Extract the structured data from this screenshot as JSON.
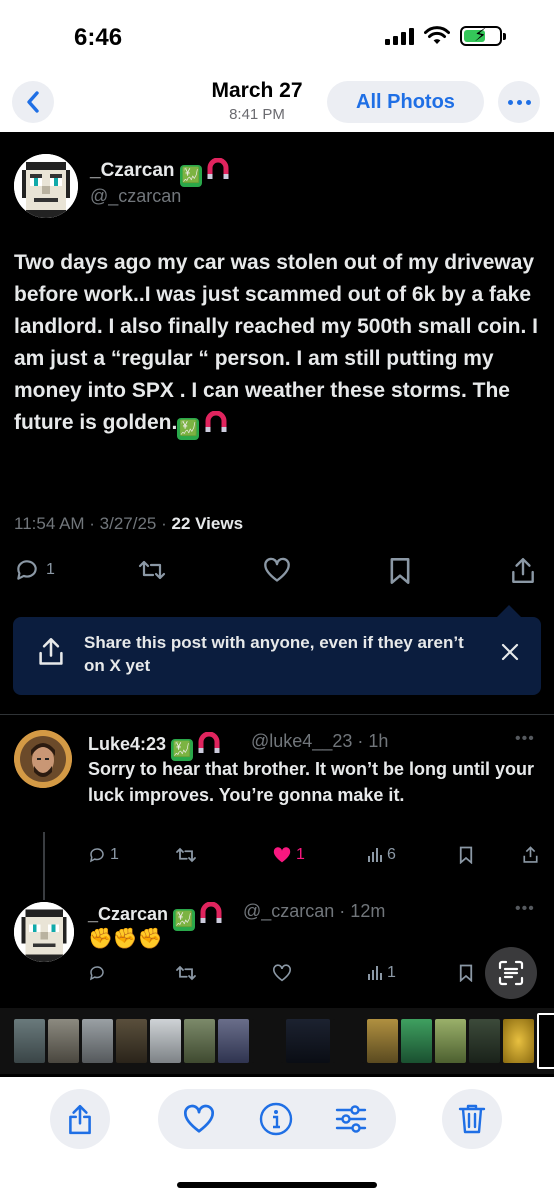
{
  "status_bar": {
    "time": "6:46"
  },
  "nav": {
    "date": "March 27",
    "time": "8:41 PM",
    "all_photos": "All Photos"
  },
  "post": {
    "display_name": "_Czarcan",
    "handle": "@_czarcan",
    "text": "Two days ago my car was stolen out of my driveway before work..I was just scammed out of 6k by a fake landlord. I also finally reached my 500th small coin. I am just a “regular “ person. I am still putting my money into SPX . I can weather these storms. The future is golden.",
    "time": "11:54 AM · 3/27/25 · ",
    "views_count": "22",
    "views_label": " Views",
    "reply_count": "1"
  },
  "share_card": {
    "text": "Share this post with anyone, even if they aren’t on X yet"
  },
  "replies": [
    {
      "display_name": "Luke4:23",
      "handle": "@luke4__23 · 1h",
      "text": "Sorry to hear that brother. It won’t be long until your luck improves. You’re gonna make it.",
      "reply_count": "1",
      "like_count": "1",
      "views": "6"
    },
    {
      "display_name": "_Czarcan",
      "handle": "@_czarcan · 12m",
      "text": "✊✊✊",
      "views": "1"
    }
  ],
  "colors": {
    "accent": "#1f6fe5",
    "like_pink": "#f91880",
    "share_card_bg": "#0b1d3e"
  }
}
